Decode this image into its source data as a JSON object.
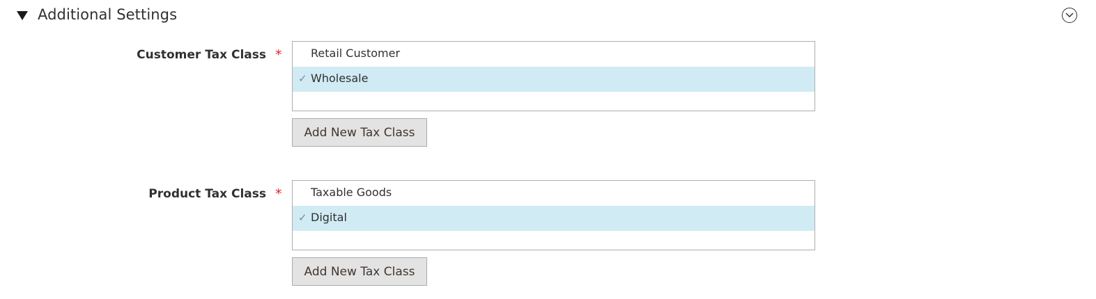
{
  "section": {
    "title": "Additional Settings",
    "expanded": true
  },
  "customer_tax_class": {
    "label": "Customer Tax Class",
    "required_mark": "*",
    "options": [
      {
        "label": "Retail Customer",
        "selected": false
      },
      {
        "label": "Wholesale",
        "selected": true
      }
    ],
    "add_button_label": "Add New Tax Class"
  },
  "product_tax_class": {
    "label": "Product Tax Class",
    "required_mark": "*",
    "options": [
      {
        "label": "Taxable Goods",
        "selected": false
      },
      {
        "label": "Digital",
        "selected": true
      }
    ],
    "add_button_label": "Add New Tax Class"
  },
  "icons": {
    "section_toggle": "triangle-down-icon",
    "collapse": "chevron-down-circle-icon",
    "selected_check": "checkmark-icon"
  },
  "colors": {
    "selected_row": "#d0ebf4",
    "required": "#e22626",
    "button_bg": "#e3e3e3"
  }
}
